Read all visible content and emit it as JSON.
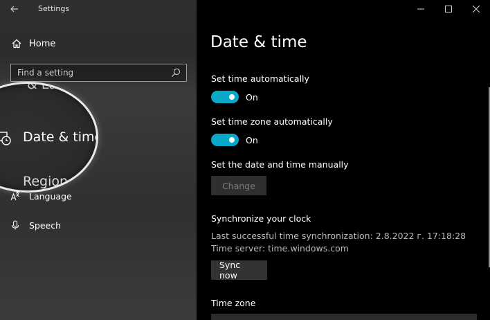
{
  "window": {
    "app_title": "Settings",
    "back_icon": "back-arrow-icon",
    "controls": {
      "minimize": "—",
      "maximize": "☐",
      "close": "✕"
    }
  },
  "sidebar": {
    "home_label": "Home",
    "search_placeholder": "Find a setting",
    "items": [
      {
        "label": "Language",
        "icon": "language-icon"
      },
      {
        "label": "Speech",
        "icon": "microphone-icon"
      }
    ],
    "magnifier": {
      "partial_above": "& Lang",
      "highlight_label": "Date & time",
      "partial_below": "Region"
    }
  },
  "main": {
    "title": "Date & time",
    "set_time_auto": {
      "label": "Set time automatically",
      "state": "On",
      "on": true
    },
    "set_tz_auto": {
      "label": "Set time zone automatically",
      "state": "On",
      "on": true
    },
    "manual": {
      "label": "Set the date and time manually",
      "button": "Change",
      "enabled": false
    },
    "sync": {
      "heading": "Synchronize your clock",
      "last_sync": "Last successful time synchronization: 2.8.2022 г. 17:18:28",
      "time_server": "Time server: time.windows.com",
      "button": "Sync now"
    },
    "time_zone": {
      "label": "Time zone"
    }
  },
  "colors": {
    "accent": "#0aa8c8",
    "main_bg": "#000000",
    "sidebar_bg": "#2e2f31"
  }
}
